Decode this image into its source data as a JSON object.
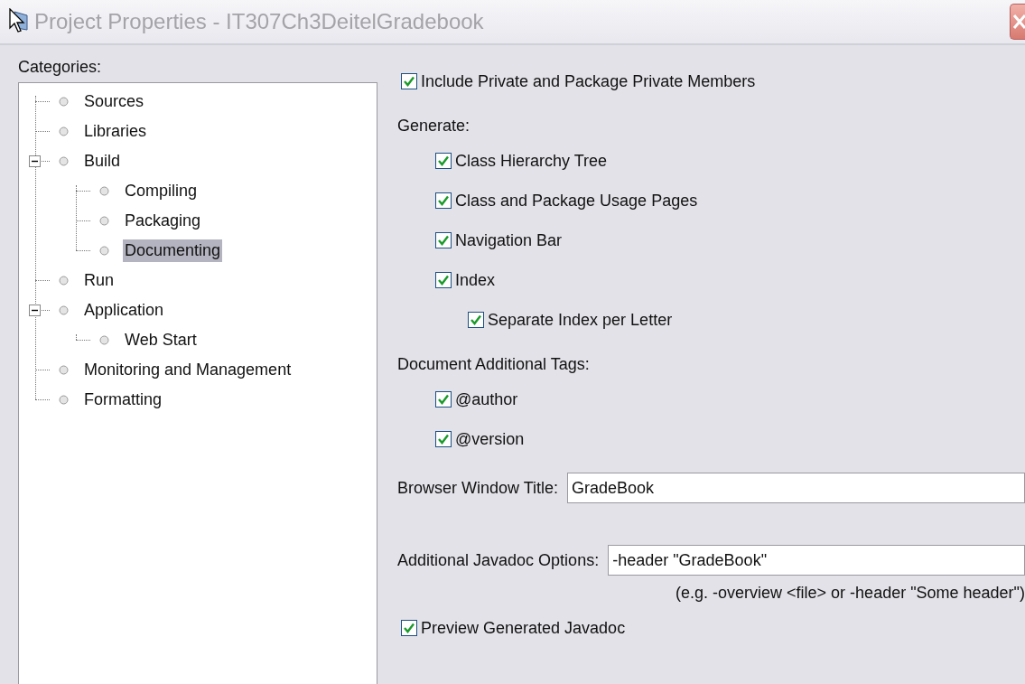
{
  "window": {
    "title": "Project Properties - IT307Ch3DeitelGradebook"
  },
  "categories": {
    "label": "Categories:",
    "items": [
      {
        "label": "Sources",
        "selected": false
      },
      {
        "label": "Libraries",
        "selected": false
      },
      {
        "label": "Build",
        "selected": false,
        "expanded": true,
        "children": [
          {
            "label": "Compiling",
            "selected": false
          },
          {
            "label": "Packaging",
            "selected": false
          },
          {
            "label": "Documenting",
            "selected": true
          }
        ]
      },
      {
        "label": "Run",
        "selected": false
      },
      {
        "label": "Application",
        "selected": false,
        "expanded": true,
        "children": [
          {
            "label": "Web Start",
            "selected": false
          }
        ]
      },
      {
        "label": "Monitoring and Management",
        "selected": false
      },
      {
        "label": "Formatting",
        "selected": false
      }
    ]
  },
  "include_private": {
    "label": "Include Private and Package Private Members",
    "checked": true
  },
  "generate": {
    "heading": "Generate:",
    "options": [
      {
        "label": "Class Hierarchy Tree",
        "checked": true
      },
      {
        "label": "Class and Package Usage Pages",
        "checked": true
      },
      {
        "label": "Navigation Bar",
        "checked": true
      },
      {
        "label": "Index",
        "checked": true,
        "children": [
          {
            "label": "Separate Index per Letter",
            "checked": true
          }
        ]
      }
    ]
  },
  "tags": {
    "heading": "Document Additional Tags:",
    "options": [
      {
        "label": "@author",
        "checked": true
      },
      {
        "label": "@version",
        "checked": true
      }
    ]
  },
  "browser_title": {
    "label": "Browser Window Title:",
    "value": "GradeBook"
  },
  "javadoc_options": {
    "label": "Additional Javadoc Options:",
    "value": "-header \"GradeBook\"",
    "hint": "(e.g. -overview <file> or -header \"Some header\")"
  },
  "preview": {
    "label": "Preview Generated Javadoc",
    "checked": true
  }
}
